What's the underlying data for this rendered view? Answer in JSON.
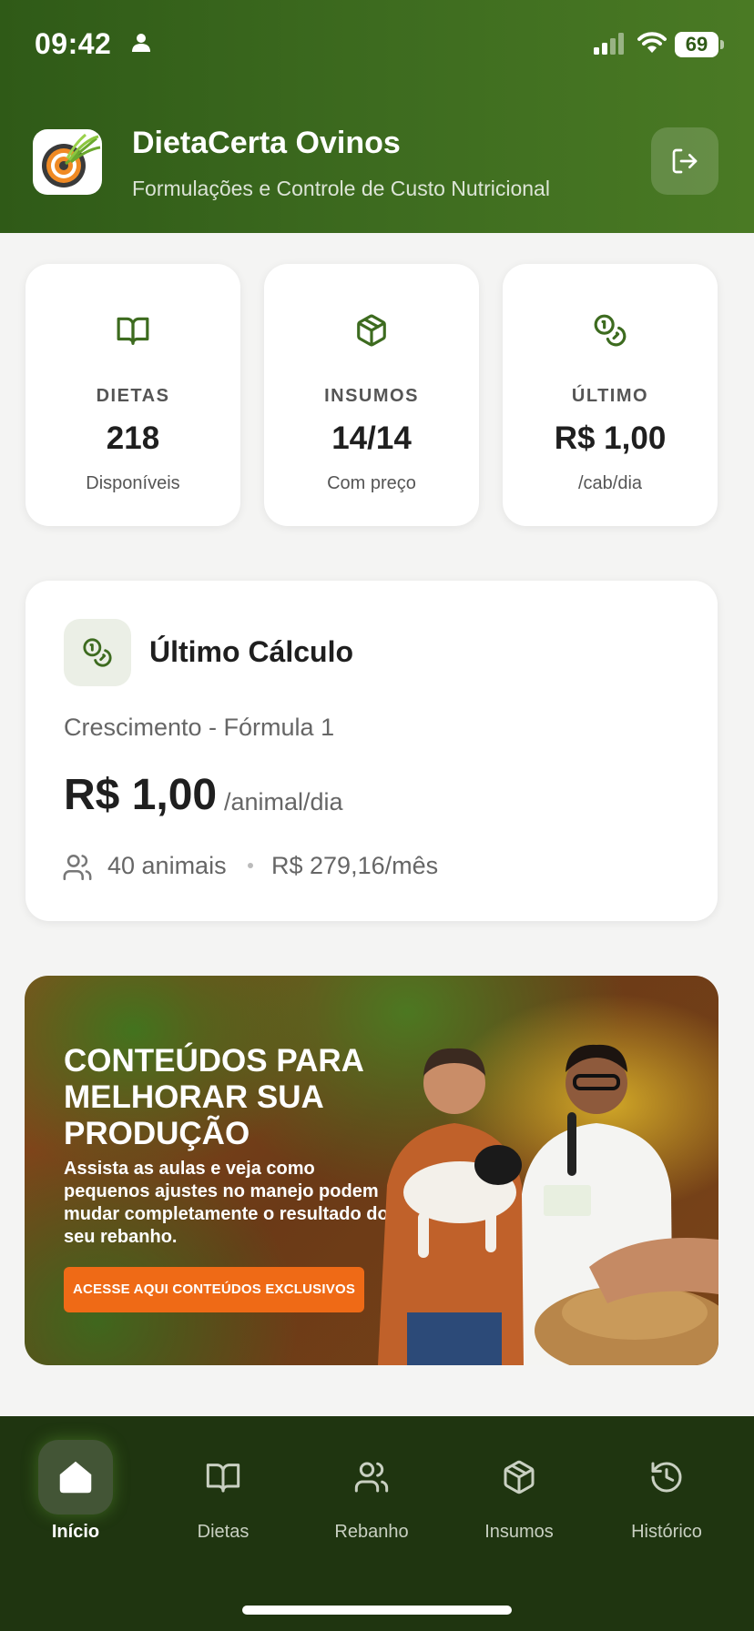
{
  "status_bar": {
    "time": "09:42",
    "battery": "69"
  },
  "header": {
    "title": "DietaCerta Ovinos",
    "subtitle": "Formulações e Controle de Custo Nutricional"
  },
  "stats": [
    {
      "label": "DIETAS",
      "value": "218",
      "caption": "Disponíveis",
      "icon": "book-icon"
    },
    {
      "label": "INSUMOS",
      "value": "14/14",
      "caption": "Com preço",
      "icon": "box-icon"
    },
    {
      "label": "ÚLTIMO",
      "value": "R$ 1,00",
      "caption": "/cab/dia",
      "icon": "coins-icon"
    }
  ],
  "last_calc": {
    "title": "Último Cálculo",
    "formula": "Crescimento - Fórmula 1",
    "price": "R$ 1,00",
    "unit": "/animal/dia",
    "animals": "40 animais",
    "monthly": "R$ 279,16/mês"
  },
  "promo": {
    "heading": "CONTEÚDOS PARA MELHORAR SUA PRODUÇÃO",
    "text": "Assista as aulas e veja como pequenos ajustes no manejo podem mudar completamente o resultado do seu rebanho.",
    "button": "ACESSE AQUI CONTEÚDOS EXCLUSIVOS"
  },
  "nav": {
    "items": [
      {
        "label": "Início",
        "icon": "home-icon",
        "active": true
      },
      {
        "label": "Dietas",
        "icon": "book-icon"
      },
      {
        "label": "Rebanho",
        "icon": "users-icon"
      },
      {
        "label": "Insumos",
        "icon": "box-icon"
      },
      {
        "label": "Histórico",
        "icon": "history-icon"
      }
    ]
  },
  "colors": {
    "header_green": "#3d6b1f",
    "nav_dark_green": "#1f3510",
    "accent_orange": "#ef6a16",
    "icon_green": "#3d6b1f"
  }
}
